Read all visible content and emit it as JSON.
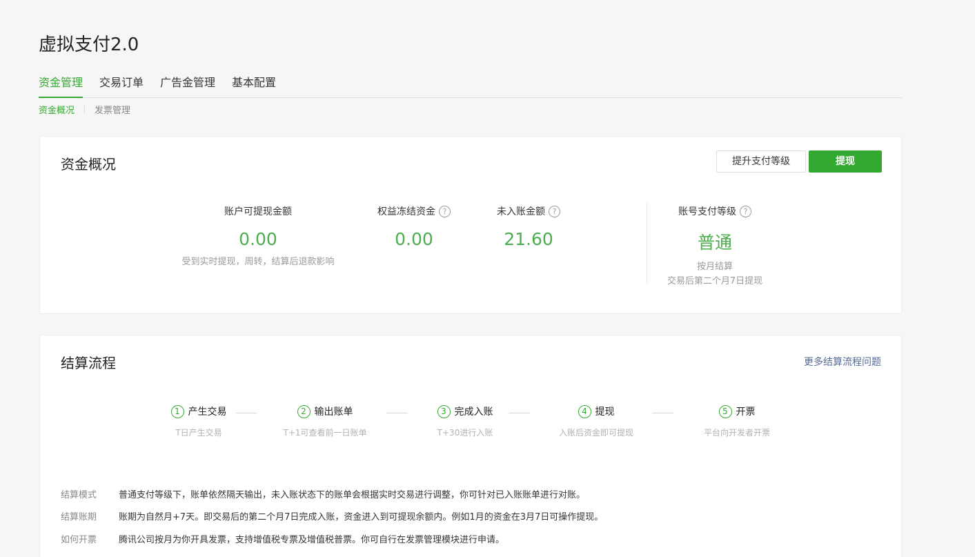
{
  "page": {
    "title": "虚拟支付2.0"
  },
  "main_tabs": [
    {
      "label": "资金管理",
      "active": true
    },
    {
      "label": "交易订单",
      "active": false
    },
    {
      "label": "广告金管理",
      "active": false
    },
    {
      "label": "基本配置",
      "active": false
    }
  ],
  "sub_tabs": [
    {
      "label": "资金概况",
      "active": true
    },
    {
      "label": "发票管理",
      "active": false
    }
  ],
  "overview": {
    "title": "资金概况",
    "upgrade_button": "提升支付等级",
    "withdraw_button": "提现",
    "stats": [
      {
        "label": "账户可提现金额",
        "value": "0.00",
        "note": "受到实时提现，周转，结算后退款影响",
        "help": false
      },
      {
        "label": "权益冻结资金",
        "value": "0.00",
        "note": "",
        "help": true
      },
      {
        "label": "未入账金额",
        "value": "21.60",
        "note": "",
        "help": true
      }
    ],
    "level": {
      "label": "账号支付等级",
      "value": "普通",
      "note1": "按月结算",
      "note2": "交易后第二个月7日提现"
    },
    "help_glyph": "?"
  },
  "settlement": {
    "title": "结算流程",
    "more_link": "更多结算流程问题",
    "steps": [
      {
        "num": "1",
        "title": "产生交易",
        "desc": "T日产生交易"
      },
      {
        "num": "2",
        "title": "输出账单",
        "desc": "T+1可查看前一日账单"
      },
      {
        "num": "3",
        "title": "完成入账",
        "desc": "T+30进行入账"
      },
      {
        "num": "4",
        "title": "提现",
        "desc": "入账后资金即可提现"
      },
      {
        "num": "5",
        "title": "开票",
        "desc": "平台向开发者开票"
      }
    ],
    "info": [
      {
        "key": "结算模式",
        "value": "普通支付等级下，账单依然隔天输出，未入账状态下的账单会根据实时交易进行调整，你可针对已入账账单进行对账。"
      },
      {
        "key": "结算账期",
        "value": "账期为自然月+7天。即交易后的第二个月7日完成入账，资金进入到可提现余额内。例如1月的资金在3月7日可操作提现。"
      },
      {
        "key": "如何开票",
        "value": "腾讯公司按月为你开具发票，支持增值税专票及增值税普票。你可自行在发票管理模块进行申请。"
      }
    ]
  },
  "colors": {
    "accent": "#34a931",
    "value_green": "#4cae4c",
    "link": "#576b95"
  }
}
